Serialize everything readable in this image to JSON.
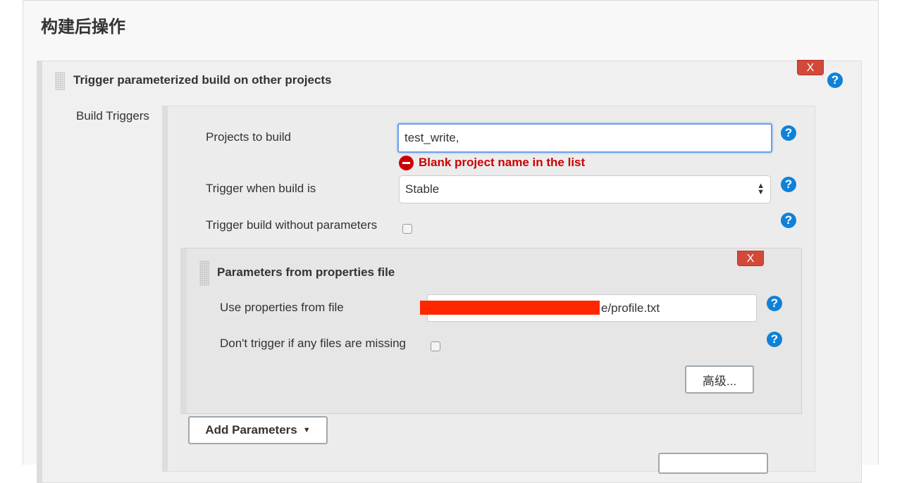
{
  "section_title": "构建后操作",
  "step": {
    "title": "Trigger parameterized build on other projects",
    "delete_label": "X",
    "help": "?",
    "build_triggers_label": "Build Triggers",
    "projects_label": "Projects to build",
    "projects_value": "test_write,",
    "error": "Blank project name in the list",
    "trigger_when_label": "Trigger when build is",
    "trigger_when_value": "Stable",
    "without_params_label": "Trigger build without parameters",
    "without_params_checked": false,
    "params": {
      "title": "Parameters from properties file",
      "delete_label": "X",
      "file_label": "Use properties from file",
      "file_value": "e/profile.txt",
      "missing_label": "Don't trigger if any files are missing",
      "missing_checked": false,
      "advanced_label": "高级..."
    },
    "add_parameters_label": "Add Parameters"
  },
  "colors": {
    "error": "#cc0000",
    "help": "#0f81d8",
    "delete": "#d24939",
    "redaction": "#ff2600"
  }
}
